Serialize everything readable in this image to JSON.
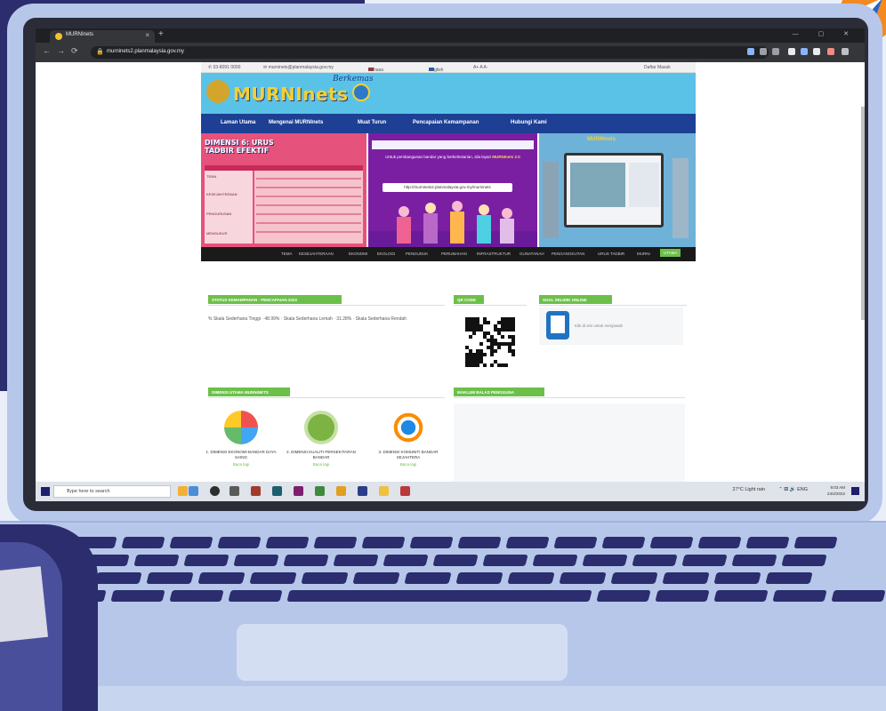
{
  "colors": {
    "navy": "#2b2d6e",
    "laptop_shell": "#b7c7ea",
    "accent_green": "#6cc04a",
    "header_sky": "#5bc2e7",
    "nav_blue": "#1d3f94",
    "banner_pink": "#e5527b",
    "banner_purple": "#7b1fa2"
  },
  "browser": {
    "tab_title": "MURNInets",
    "tab_close": "×",
    "new_tab": "+",
    "window_controls": "— ▢ ✕",
    "url": "murninets2.planmalaysia.gov.my",
    "nav": {
      "back": "←",
      "forward": "→",
      "reload": "⟳"
    }
  },
  "topbar": {
    "phone": "✆ 03-8091 0000",
    "email": "✉ murninets@planmalaysia.gov.my",
    "lang_ms": "Bahasa Melayu",
    "lang_en": "English",
    "font_size": "A+ A A-",
    "login": "Daftar Masuk"
  },
  "brand": {
    "name": "MURNInets",
    "tagline": "Berkemas"
  },
  "nav": [
    "Laman Utama",
    "Mengenai MURNInets",
    "Muat Turun",
    "Pencapaian Kemampanan",
    "Hubungi Kami"
  ],
  "banner": {
    "left_title": "DIMENSI 6: URUS TADBIR EFEKTIF",
    "left_labels": [
      "TEMA",
      "KESEJAHTERAAN",
      "PENGURUSAN",
      "MENGUKUR"
    ],
    "mid_text": "Untuk pembangunan bandar yang berkelestarian, sila layari",
    "mid_brand": "MURNInets 2.0",
    "mid_link": "http://murninets2.planmalaysia.gov.my/murninets",
    "right_brand": "MURNInets"
  },
  "ticker": [
    "TEMA",
    "KESEJAHTERAAN",
    "EKONOMI",
    "EKOLOGI",
    "PENDUDUK",
    "PERUMAHAN",
    "INFRASTRUKTUR",
    "GUNATANAH",
    "PENGANGKUTAN",
    "URUS TADBIR",
    "MURNI",
    "UTAMA"
  ],
  "panels": {
    "performance_title": "STATUS KEMAMPANAN · PENCAPAIAN 2023",
    "performance_text": "% Skala Sederhana Tinggi · 48.99% · Skala Sederhana Lemah · 31.28% · Skala Sederhana Rendah",
    "performance_values": [
      "48.99%",
      "31.28%"
    ],
    "qr_title": "QR CODE",
    "survey_title": "SOAL SELIDIK ONLINE",
    "survey_link": "Klik di sini untuk menjawab",
    "dimension_title": "DIMENSI UTAMA MURNINETS",
    "feedback_title": "MAKLUM BALAS PENGGUNA"
  },
  "pillars": [
    {
      "title": "1. DIMENSI EKONOMI BANDAR DAYA SAING",
      "more": "Baca lagi"
    },
    {
      "title": "2. DIMENSI KUALITI PERSEKITARAN BANDAR",
      "more": "Baca lagi"
    },
    {
      "title": "3. DIMENSI KOMUNITI BANDAR SEJAHTERA",
      "more": "Baca lagi"
    }
  ],
  "taskbar": {
    "search_placeholder": "Type here to search",
    "weather": "27°C Light rain",
    "tray": "⌃ ⚅ 🔊 ENG",
    "time": "9:03 AM",
    "date": "24/4/2022"
  }
}
